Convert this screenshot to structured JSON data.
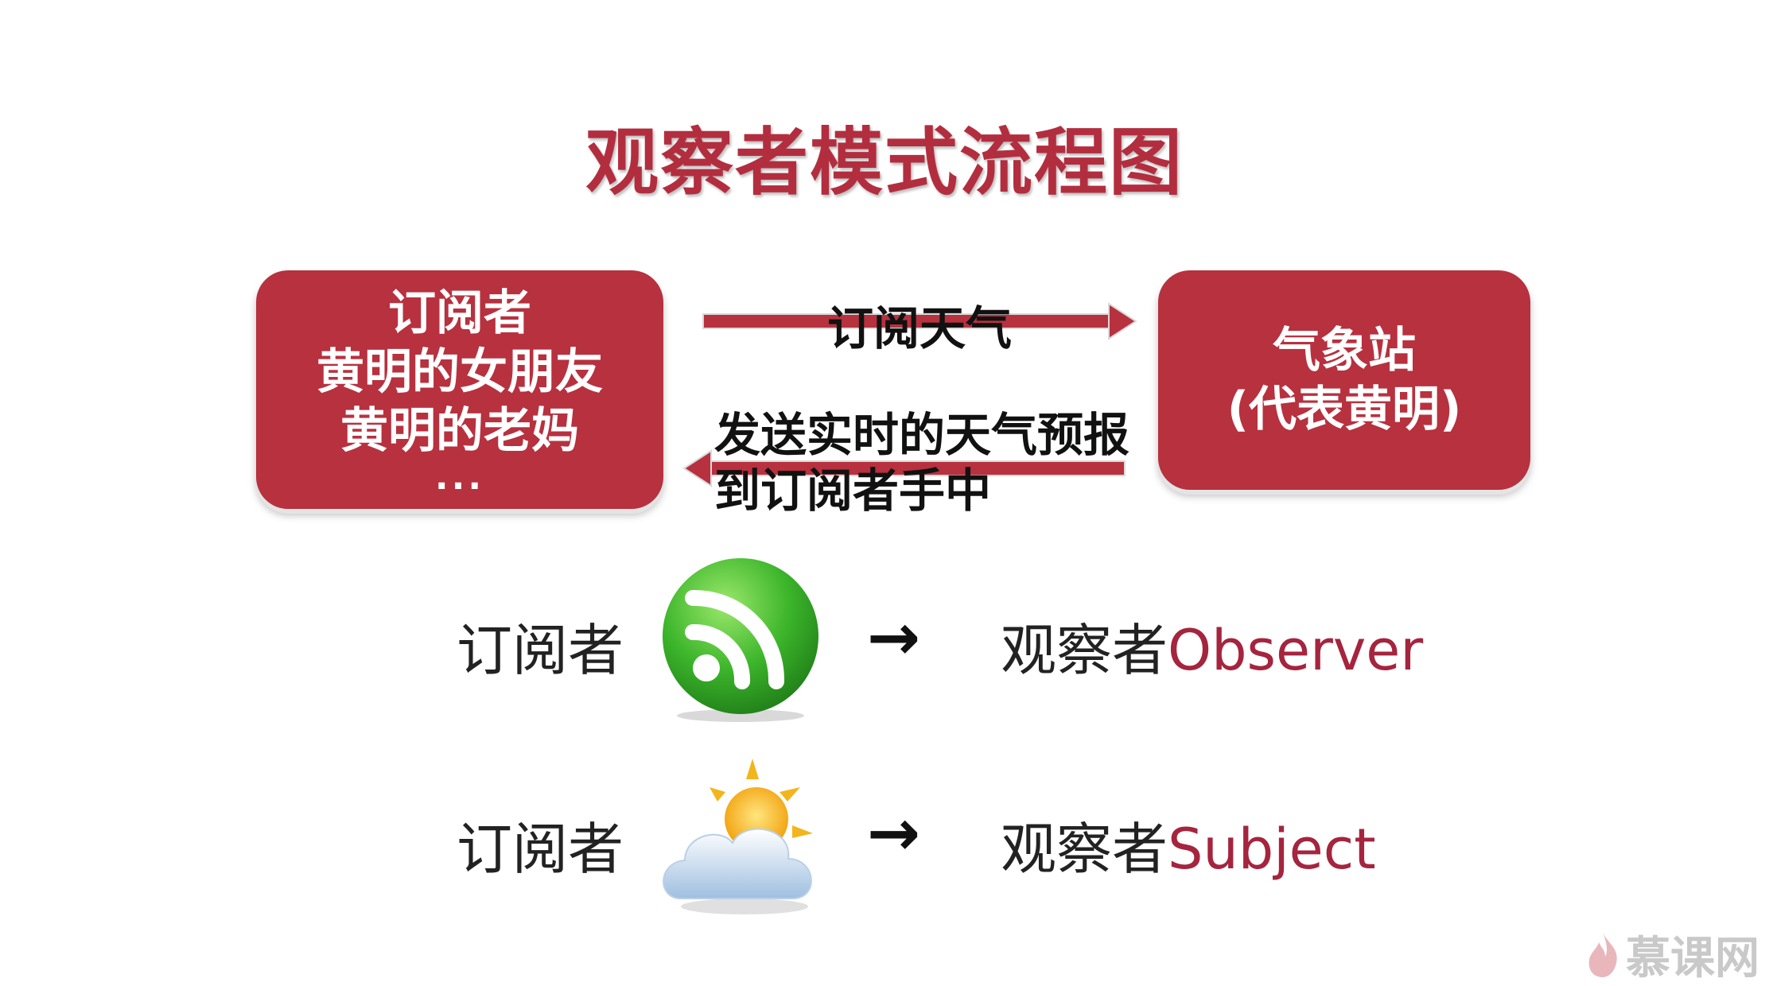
{
  "title": "观察者模式流程图",
  "left_box": {
    "lines": [
      "订阅者",
      "黄明的女朋友",
      "黄明的老妈",
      "..."
    ]
  },
  "right_box": {
    "lines": [
      "气象站",
      "(代表黄明)"
    ]
  },
  "arrows": {
    "subscribe_label": "订阅天气",
    "send_label_1": "发送实时的天气预报",
    "send_label_2": "到订阅者手中"
  },
  "rows": [
    {
      "left": "订阅者",
      "icon": "rss-icon",
      "arrow": "→",
      "right_cn": "观察者",
      "right_en": "Observer"
    },
    {
      "left": "订阅者",
      "icon": "weather-icon",
      "arrow": "→",
      "right_cn": "观察者",
      "right_en": "Subject"
    }
  ],
  "watermark": "慕课网",
  "colors": {
    "title": "#b22e3f",
    "box": "#b7313f",
    "accent": "#a5243e",
    "rss_green": "#3cb52b",
    "watermark": "#c9c9c9"
  }
}
